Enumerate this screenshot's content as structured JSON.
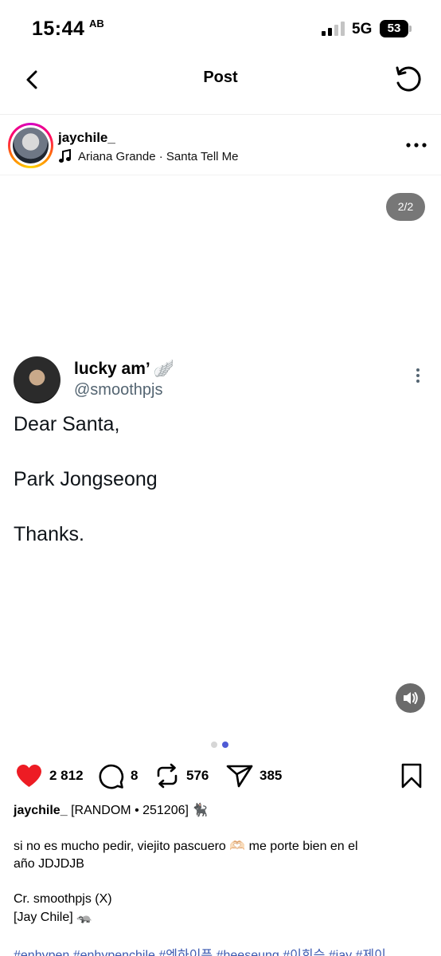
{
  "status_bar": {
    "time": "15:44",
    "extra": "AB",
    "network": "5G",
    "battery": "53"
  },
  "nav": {
    "title": "Post"
  },
  "post_header": {
    "username": "jaychile_",
    "music": "Ariana Grande · Santa Tell Me"
  },
  "media": {
    "page_indicator": "2/2",
    "current_slide": 2,
    "total_slides": 2,
    "tweet": {
      "name": "lucky am’",
      "name_emoji": "🪽",
      "handle": "@smoothpjs",
      "lines": [
        "Dear Santa,",
        "Park Jongseong",
        "Thanks."
      ]
    }
  },
  "actions": {
    "likes": "2 812",
    "comments": "8",
    "reposts": "576",
    "shares": "385"
  },
  "caption": {
    "username": "jaychile_",
    "title": "[RANDOM • 251206] 🐈‍⬛",
    "body_line1": "si no es mucho pedir, viejito pascuero 🫶🏻 me porte bien en el",
    "body_line2": "año JDJDJB",
    "credit_line1": "Cr. smoothpjs (X)",
    "credit_line2": "[Jay Chile] 🦡",
    "hashtags": "#enhypen #enhypenchile #엔하이픈 #heeseung #이희승 #jay #제이"
  },
  "colors": {
    "like_red": "#ed1c24",
    "hashtag_blue": "#3a58b0",
    "active_dot": "#4f5bd5",
    "inactive_dot": "#d6d6d6"
  }
}
